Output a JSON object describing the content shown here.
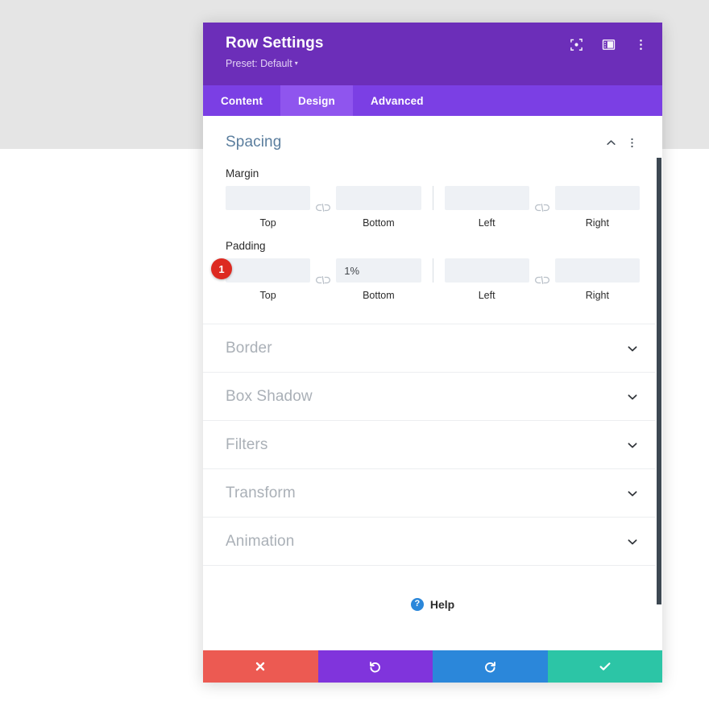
{
  "header": {
    "title": "Row Settings",
    "preset_label": "Preset: Default",
    "preset_caret": "▾",
    "icons": [
      {
        "name": "focus-target-icon",
        "label": "Focus"
      },
      {
        "name": "panel-layout-icon",
        "label": "Panel Layout"
      },
      {
        "name": "more-options-icon",
        "label": "More Options"
      }
    ]
  },
  "tabs": [
    {
      "label": "Content",
      "active": false
    },
    {
      "label": "Design",
      "active": true
    },
    {
      "label": "Advanced",
      "active": false
    }
  ],
  "spacing": {
    "title": "Spacing",
    "collapse_icon": "chevron-up-icon",
    "menu_icon": "more-options-icon",
    "margin": {
      "label": "Margin",
      "fields": [
        {
          "sub_label": "Top",
          "value": "",
          "placeholder": ""
        },
        {
          "sub_label": "Bottom",
          "value": "",
          "placeholder": ""
        },
        {
          "sub_label": "Left",
          "value": "",
          "placeholder": ""
        },
        {
          "sub_label": "Right",
          "value": "",
          "placeholder": ""
        }
      ]
    },
    "padding": {
      "label": "Padding",
      "badge": "1",
      "fields": [
        {
          "sub_label": "Top",
          "value": "",
          "placeholder": ""
        },
        {
          "sub_label": "Bottom",
          "value": "1%",
          "placeholder": ""
        },
        {
          "sub_label": "Left",
          "value": "",
          "placeholder": ""
        },
        {
          "sub_label": "Right",
          "value": "",
          "placeholder": ""
        }
      ]
    }
  },
  "sections": [
    {
      "label": "Border"
    },
    {
      "label": "Box Shadow"
    },
    {
      "label": "Filters"
    },
    {
      "label": "Transform"
    },
    {
      "label": "Animation"
    }
  ],
  "help": {
    "label": "Help",
    "icon_glyph": "?"
  },
  "footer": {
    "buttons": [
      {
        "name": "cancel-button",
        "icon": "close-icon",
        "color": "#ec5a52"
      },
      {
        "name": "undo-button",
        "icon": "undo-icon",
        "color": "#8034dc"
      },
      {
        "name": "redo-button",
        "icon": "redo-icon",
        "color": "#2b87da"
      },
      {
        "name": "save-button",
        "icon": "check-icon",
        "color": "#2cc5a6"
      }
    ]
  },
  "theme": {
    "header_purple": "#6c2eb9",
    "tabbar_purple": "#7b3fe4",
    "active_tab_purple": "#8f55ee",
    "section_title_blue": "#5b7e9e",
    "badge_red": "#dd2a21",
    "input_bg": "#eef1f5",
    "page_band": "#e5e5e5"
  }
}
